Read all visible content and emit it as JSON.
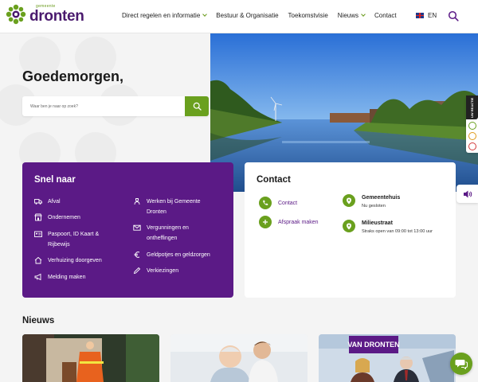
{
  "header": {
    "logo_small": "gemeente",
    "logo_big": "dronten",
    "nav": [
      {
        "label": "Direct regelen en informatie",
        "dropdown": true
      },
      {
        "label": "Bestuur & Organisatie",
        "dropdown": false
      },
      {
        "label": "Toekomstvisie",
        "dropdown": false
      },
      {
        "label": "Nieuws",
        "dropdown": true
      },
      {
        "label": "Contact",
        "dropdown": false
      }
    ],
    "language": "EN"
  },
  "hero": {
    "greeting": "Goedemorgen,",
    "search_placeholder": "Waar ben je naar op zoek?"
  },
  "side": {
    "reaction_label": "UW REACTIE"
  },
  "snel_naar": {
    "title": "Snel naar",
    "left_items": [
      {
        "label": "Afval",
        "icon": "truck-icon"
      },
      {
        "label": "Ondernemen",
        "icon": "shop-icon"
      },
      {
        "label": "Paspoort, ID Kaart & Rijbewijs",
        "icon": "id-card-icon"
      },
      {
        "label": "Verhuizing doorgeven",
        "icon": "home-icon"
      },
      {
        "label": "Melding maken",
        "icon": "megaphone-icon"
      }
    ],
    "right_items": [
      {
        "label": "Werken bij Gemeente Dronten",
        "icon": "worker-icon"
      },
      {
        "label": "Vergunningen en ontheffingen",
        "icon": "envelope-icon"
      },
      {
        "label": "Geldpotjes en geldzorgen",
        "icon": "euro-icon"
      },
      {
        "label": "Verkiezingen",
        "icon": "pencil-icon"
      }
    ]
  },
  "contact": {
    "title": "Contact",
    "links": [
      {
        "label": "Contact",
        "icon": "phone-icon"
      },
      {
        "label": "Afspraak maken",
        "icon": "plus-icon"
      }
    ],
    "locations": [
      {
        "title": "Gemeentehuis",
        "sub": "Nu gesloten"
      },
      {
        "title": "Milieustraat",
        "sub": "Straks open van 09:00 tot 13:00 uur"
      }
    ]
  },
  "news": {
    "title": "Nieuws",
    "card3_banner": "VAN DRONTEN"
  },
  "colors": {
    "purple": "#5b1a86",
    "green": "#6aa01e",
    "background": "#f4f4f4"
  }
}
